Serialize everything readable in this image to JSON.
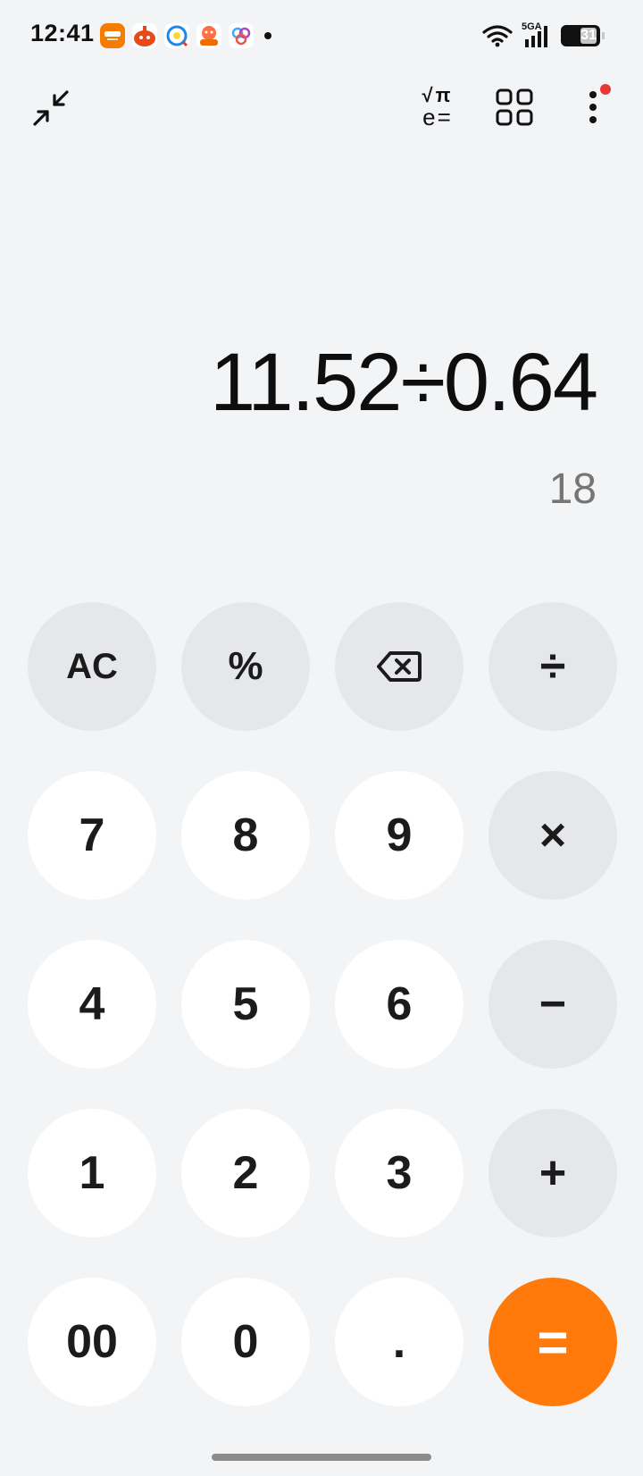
{
  "status_bar": {
    "time": "12:41",
    "network": "5GA",
    "battery": "31",
    "app_icons": [
      "shop-icon",
      "game-icon",
      "browser-icon",
      "mascot-icon",
      "flower-icon"
    ]
  },
  "toolbar": {
    "scientific_top": "√π",
    "scientific_bottom": "e="
  },
  "display": {
    "expression": "11.52÷0.64",
    "result": "18"
  },
  "keys": {
    "ac": "AC",
    "percent": "%",
    "divide": "÷",
    "seven": "7",
    "eight": "8",
    "nine": "9",
    "multiply": "×",
    "four": "4",
    "five": "5",
    "six": "6",
    "minus": "−",
    "one": "1",
    "two": "2",
    "three": "3",
    "plus": "+",
    "double_zero": "00",
    "zero": "0",
    "decimal": ".",
    "equals": "="
  },
  "colors": {
    "background": "#f3f4f6",
    "key_light": "#ffffff",
    "key_gray": "#e6e7ea",
    "accent": "#ff7a0a",
    "result_text": "#757575"
  }
}
